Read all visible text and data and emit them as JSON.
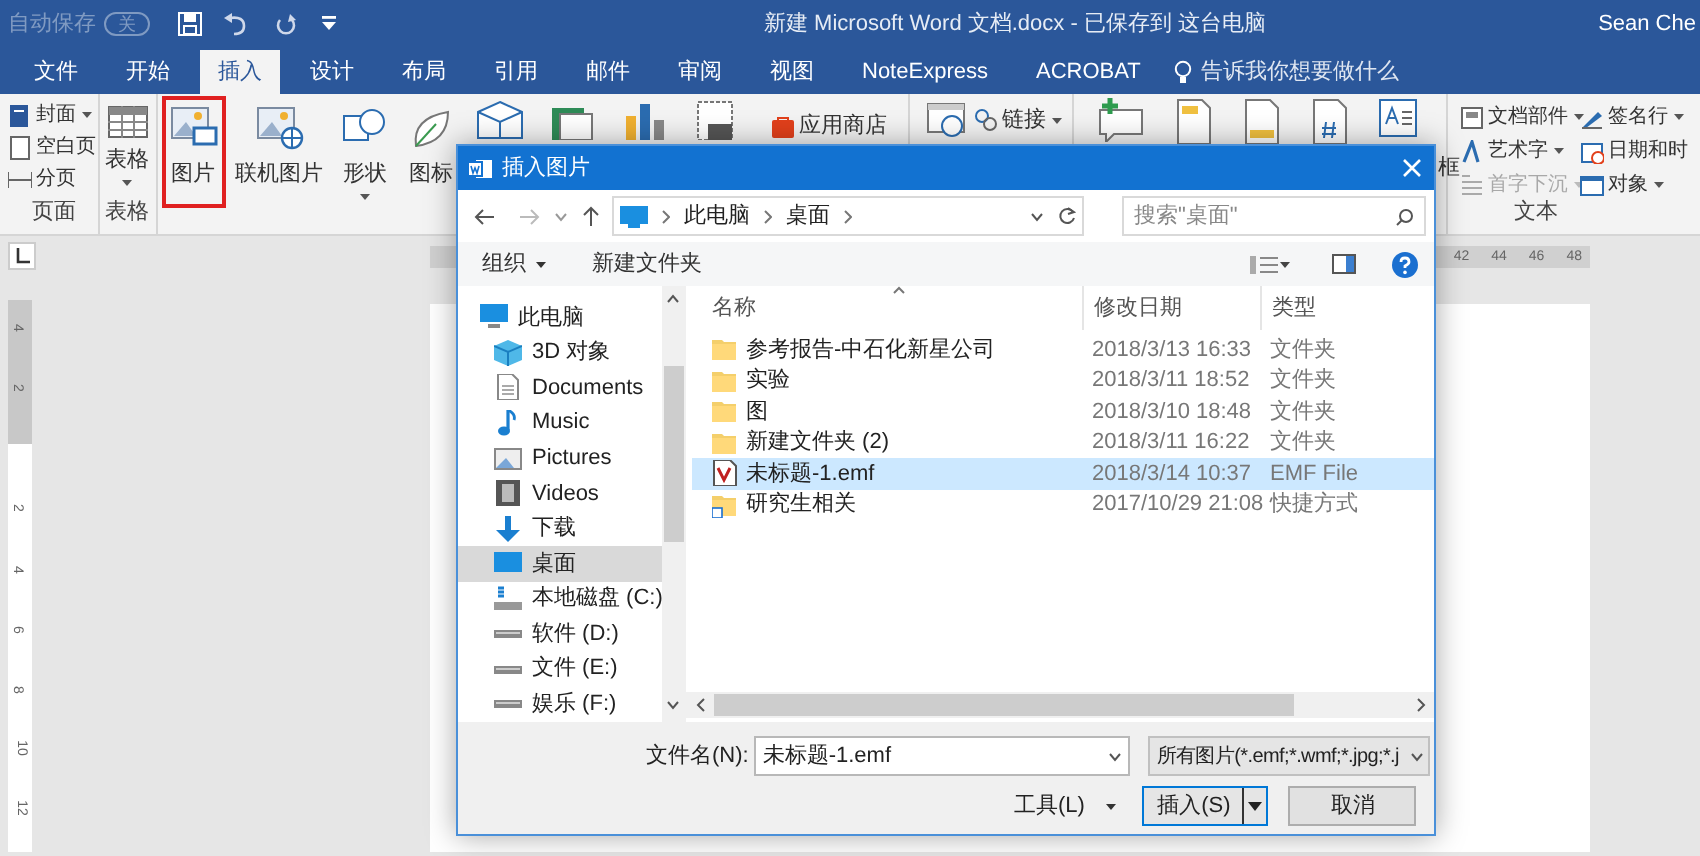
{
  "quick_access": {
    "autosave_label": "自动保存",
    "autosave_state": "关"
  },
  "window": {
    "title": "新建 Microsoft Word 文档.docx - 已保存到 这台电脑",
    "user": "Sean Che"
  },
  "tabs": [
    {
      "label": "文件",
      "selected": false
    },
    {
      "label": "开始",
      "selected": false
    },
    {
      "label": "插入",
      "selected": true
    },
    {
      "label": "设计",
      "selected": false
    },
    {
      "label": "布局",
      "selected": false
    },
    {
      "label": "引用",
      "selected": false
    },
    {
      "label": "邮件",
      "selected": false
    },
    {
      "label": "审阅",
      "selected": false
    },
    {
      "label": "视图",
      "selected": false
    },
    {
      "label": "NoteExpress",
      "selected": false
    },
    {
      "label": "ACROBAT",
      "selected": false
    }
  ],
  "tell_me": "告诉我你想要做什么",
  "ribbon": {
    "pages": {
      "items": [
        {
          "label": "封面",
          "dropdown": true
        },
        {
          "label": "空白页",
          "dropdown": false
        },
        {
          "label": "分页",
          "dropdown": false
        }
      ],
      "group_label": "页面"
    },
    "table": {
      "label": "表格",
      "group_label": "表格"
    },
    "illustrations": [
      {
        "label": "图片",
        "highlighted": true,
        "dropdown": false
      },
      {
        "label": "联机图片",
        "highlighted": false,
        "dropdown": false
      },
      {
        "label": "形状",
        "highlighted": false,
        "dropdown": true
      },
      {
        "label": "图标",
        "highlighted": false,
        "dropdown": false
      }
    ],
    "store": "应用商店",
    "link": "链接",
    "textbox_label": "框",
    "text_items": [
      {
        "label": "文档部件",
        "disabled": false,
        "dropdown": true
      },
      {
        "label": "艺术字",
        "disabled": false,
        "dropdown": true
      },
      {
        "label": "首字下沉",
        "disabled": true,
        "dropdown": true
      },
      {
        "label": "签名行",
        "disabled": false,
        "dropdown": true
      },
      {
        "label": "日期和时",
        "disabled": false,
        "dropdown": false
      },
      {
        "label": "对象",
        "disabled": false,
        "dropdown": true
      }
    ],
    "text_group_label": "文本"
  },
  "ruler": {
    "numbers": [
      "42",
      "44",
      "46",
      "48"
    ],
    "vertical_numbers": [
      "4",
      "2",
      "2",
      "4",
      "6",
      "8",
      "10",
      "12"
    ]
  },
  "dialog": {
    "title": "插入图片",
    "address": [
      "此电脑",
      "桌面"
    ],
    "search_placeholder": "搜索\"桌面\"",
    "organize": "组织",
    "new_folder": "新建文件夹",
    "nav": [
      {
        "label": "此电脑",
        "kind": "pc",
        "selected": false
      },
      {
        "label": "3D 对象",
        "kind": "objects",
        "selected": false
      },
      {
        "label": "Documents",
        "kind": "documents",
        "selected": false
      },
      {
        "label": "Music",
        "kind": "music",
        "selected": false
      },
      {
        "label": "Pictures",
        "kind": "pictures",
        "selected": false
      },
      {
        "label": "Videos",
        "kind": "videos",
        "selected": false
      },
      {
        "label": "下载",
        "kind": "downloads",
        "selected": false
      },
      {
        "label": "桌面",
        "kind": "desktop",
        "selected": true
      },
      {
        "label": "本地磁盘 (C:)",
        "kind": "system_drive",
        "selected": false
      },
      {
        "label": "软件 (D:)",
        "kind": "drive",
        "selected": false
      },
      {
        "label": "文件 (E:)",
        "kind": "drive",
        "selected": false
      },
      {
        "label": "娱乐 (F:)",
        "kind": "drive",
        "selected": false
      }
    ],
    "columns": [
      "名称",
      "修改日期",
      "类型"
    ],
    "files": [
      {
        "name": "参考报告-中石化新星公司",
        "date": "2018/3/13 16:33",
        "type": "文件夹",
        "kind": "folder",
        "selected": false
      },
      {
        "name": "实验",
        "date": "2018/3/11 18:52",
        "type": "文件夹",
        "kind": "folder",
        "selected": false
      },
      {
        "name": "图",
        "date": "2018/3/10 18:48",
        "type": "文件夹",
        "kind": "folder",
        "selected": false
      },
      {
        "name": "新建文件夹 (2)",
        "date": "2018/3/11 16:22",
        "type": "文件夹",
        "kind": "folder",
        "selected": false
      },
      {
        "name": "未标题-1.emf",
        "date": "2018/3/14 10:37",
        "type": "EMF File",
        "kind": "emf",
        "selected": true
      },
      {
        "name": "研究生相关",
        "date": "2017/10/29 21:08",
        "type": "快捷方式",
        "kind": "shortcut",
        "selected": false
      }
    ],
    "filename_label": "文件名(N):",
    "filename_value": "未标题-1.emf",
    "filter": "所有图片(*.emf;*.wmf;*.jpg;*.j",
    "tools": "工具(L)",
    "insert": "插入(S)",
    "cancel": "取消"
  }
}
